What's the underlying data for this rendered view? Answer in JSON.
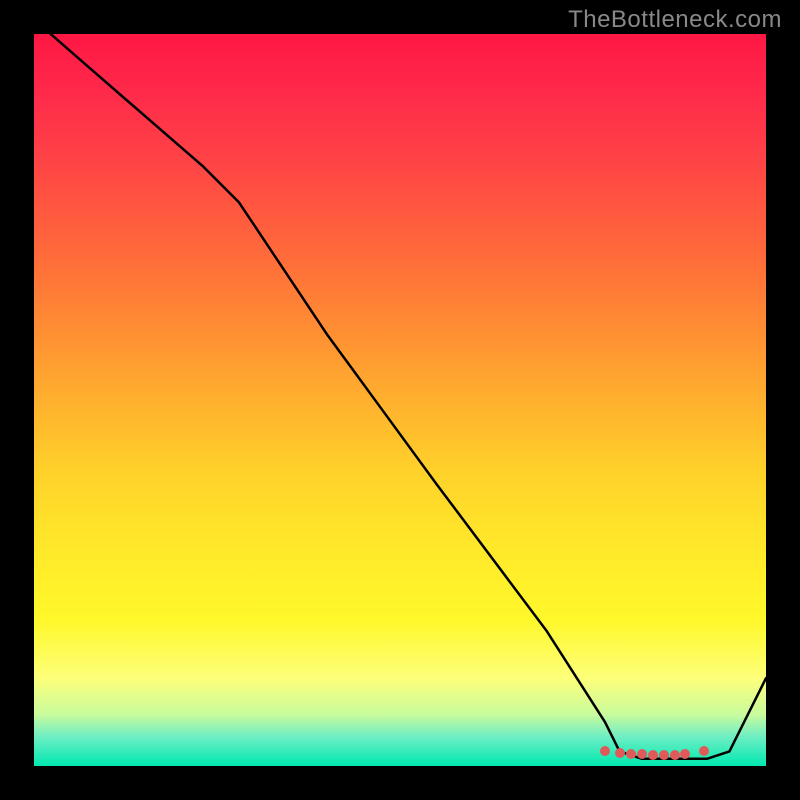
{
  "watermark": "TheBottleneck.com",
  "chart_data": {
    "type": "line",
    "title": "",
    "xlabel": "",
    "ylabel": "",
    "xlim": [
      0,
      100
    ],
    "ylim": [
      0,
      100
    ],
    "grid": false,
    "legend": false,
    "series": [
      {
        "name": "bottleneck-curve",
        "color": "#000000",
        "x": [
          0,
          8,
          23,
          28,
          40,
          55,
          70,
          78,
          80,
          83,
          86,
          89,
          92,
          95,
          100
        ],
        "values": [
          102,
          95,
          82,
          77,
          59,
          38.5,
          18.5,
          6,
          2,
          1,
          1,
          1,
          1,
          2,
          12
        ]
      }
    ],
    "markers": {
      "color": "#e05a5a",
      "points": [
        {
          "x": 78,
          "y": 2.0
        },
        {
          "x": 80,
          "y": 1.8
        },
        {
          "x": 81.5,
          "y": 1.7
        },
        {
          "x": 83,
          "y": 1.6
        },
        {
          "x": 84.5,
          "y": 1.5
        },
        {
          "x": 86,
          "y": 1.5
        },
        {
          "x": 87.5,
          "y": 1.5
        },
        {
          "x": 89,
          "y": 1.7
        },
        {
          "x": 91.5,
          "y": 2.0
        }
      ]
    },
    "background_gradient": {
      "top": "#ff1744",
      "bottom": "#00e8b0"
    }
  }
}
